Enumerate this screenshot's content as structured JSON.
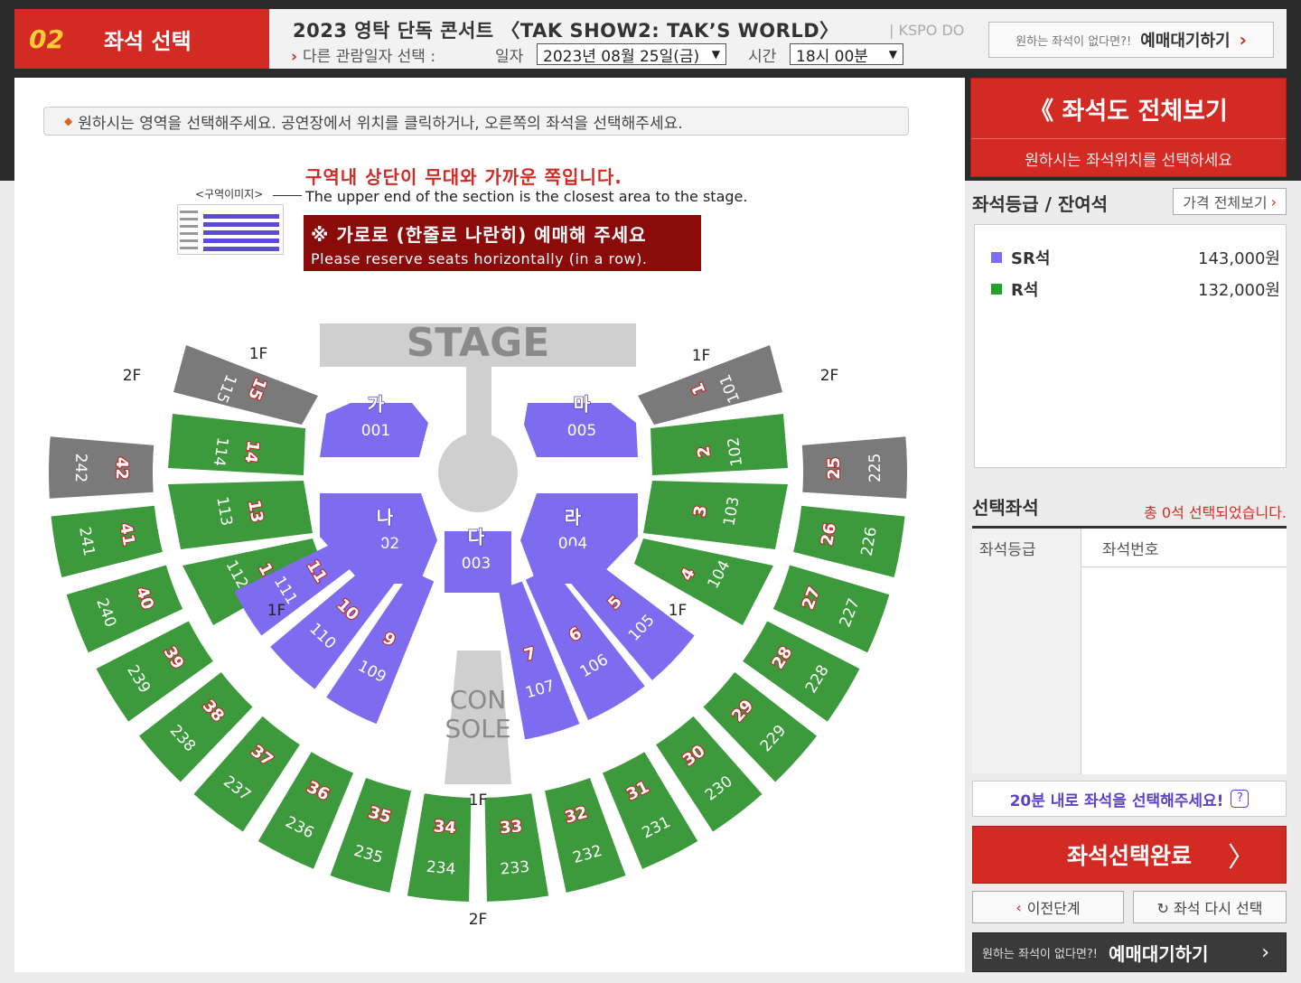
{
  "header": {
    "step_num": "02",
    "step_label": "좌석 선택",
    "concert_title": "2023 영탁 단독 콘서트 〈TAK SHOW2: TAK’S WORLD〉",
    "venue": "| KSPO DO",
    "other_date_label": "다른 관람일자 선택 :",
    "date_label": "일자",
    "date_value": "2023년 08월 25일(금)",
    "time_label": "시간",
    "time_value": "18시 00분",
    "wait_small": "원하는 좌석이 없다면?!",
    "wait_big": "예매대기하기",
    "wait_chev": "›"
  },
  "notice": "원하시는 영역을 선택해주세요. 공연장에서 위치를 클릭하거나, 오른쪽의 좌석을 선택해주세요.",
  "hints": {
    "red": "구역내 상단이 무대와 가까운 쪽입니다.",
    "en": "The upper end of the section is the closest area to the stage.",
    "zone_image_label": "<구역이미지>",
    "warn_ko": "※ 가로로 (한줄로 나란히) 예매해 주세요",
    "warn_en": "Please reserve seats horizontally (in a row)."
  },
  "map": {
    "stage": "STAGE",
    "console_1": "CON",
    "console_2": "SOLE",
    "floor_labels": [
      "1F",
      "2F",
      "1F",
      "2F",
      "1F",
      "1F",
      "1F",
      "2F"
    ],
    "center": [
      {
        "kor": "가",
        "num": "001"
      },
      {
        "kor": "나",
        "num": "002"
      },
      {
        "kor": "다",
        "num": "003"
      },
      {
        "kor": "라",
        "num": "004"
      },
      {
        "kor": "마",
        "num": "005"
      }
    ],
    "left1f": [
      {
        "n": "15",
        "t": "115"
      },
      {
        "n": "14",
        "t": "114"
      },
      {
        "n": "13",
        "t": "113"
      },
      {
        "n": "12",
        "t": "112"
      }
    ],
    "right1f": [
      {
        "n": "1",
        "t": "101"
      },
      {
        "n": "2",
        "t": "102"
      },
      {
        "n": "3",
        "t": "103"
      },
      {
        "n": "4",
        "t": "104"
      }
    ],
    "bottom1f": [
      {
        "n": "11",
        "t": "111"
      },
      {
        "n": "10",
        "t": "110"
      },
      {
        "n": "9",
        "t": "109"
      },
      {
        "n": "7",
        "t": "107"
      },
      {
        "n": "6",
        "t": "106"
      },
      {
        "n": "5",
        "t": "105"
      }
    ],
    "ring2f": [
      {
        "n": "42",
        "t": "242"
      },
      {
        "n": "41",
        "t": "241"
      },
      {
        "n": "40",
        "t": "240"
      },
      {
        "n": "39",
        "t": "239"
      },
      {
        "n": "38",
        "t": "238"
      },
      {
        "n": "37",
        "t": "237"
      },
      {
        "n": "36",
        "t": "236"
      },
      {
        "n": "35",
        "t": "235"
      },
      {
        "n": "34",
        "t": "234"
      },
      {
        "n": "33",
        "t": "233"
      },
      {
        "n": "32",
        "t": "232"
      },
      {
        "n": "31",
        "t": "231"
      },
      {
        "n": "30",
        "t": "230"
      },
      {
        "n": "29",
        "t": "229"
      },
      {
        "n": "28",
        "t": "228"
      },
      {
        "n": "27",
        "t": "227"
      },
      {
        "n": "26",
        "t": "226"
      },
      {
        "n": "25",
        "t": "225"
      }
    ]
  },
  "side": {
    "fullview_title": "《 좌석도 전체보기",
    "fullview_sub": "원하시는 좌석위치를 선택하세요",
    "grade_title": "좌석등급 / 잔여석",
    "price_all": "가격 전체보기",
    "price_chev": "›",
    "grades": [
      {
        "name": "SR석",
        "price": "143,000원",
        "color": "#7d6cf0"
      },
      {
        "name": "R석",
        "price": "132,000원",
        "color": "#22a22a"
      }
    ],
    "selected_title": "선택좌석",
    "selected_count": "총 0석 선택되었습니다.",
    "col_grade": "좌석등급",
    "col_seat": "좌석번호",
    "timer": "20분 내로 좌석을 선택해주세요!",
    "timer_q": "?",
    "complete": "좌석선택완료",
    "complete_chev": "〉",
    "prev": "이전단계",
    "prev_chev": "‹",
    "reset": "↻ 좌석 다시 선택",
    "wait_small": "원하는 좌석이 없다면?!",
    "wait_big": "예매대기하기",
    "wait_chev": "›"
  },
  "colors": {
    "accent": "#d42a24",
    "green": "#3c9a3c",
    "purple": "#7d6cf0",
    "gray": "#7a7a7a"
  }
}
